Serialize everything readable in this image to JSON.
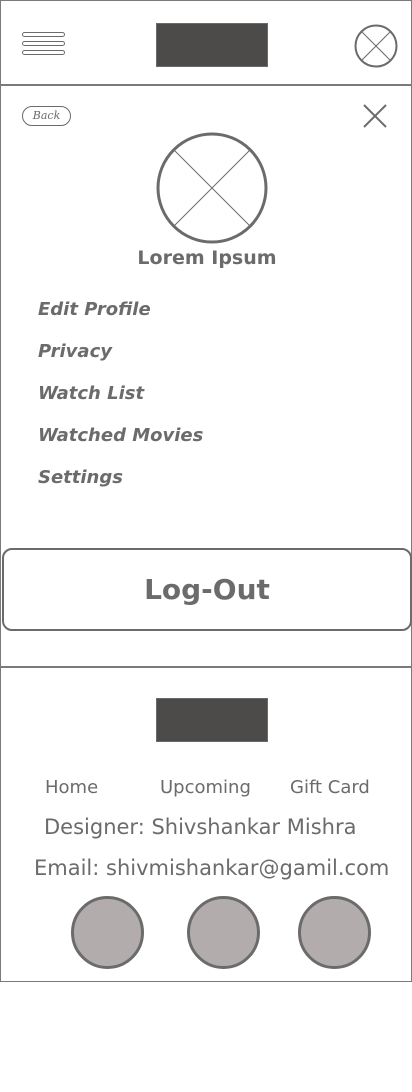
{
  "header": {
    "menu_icon": "hamburger-icon",
    "logo": "logo-placeholder",
    "avatar_icon": "image-placeholder-icon"
  },
  "panel": {
    "back_label": "Back",
    "close_icon": "close-icon",
    "profile_icon": "image-placeholder-icon",
    "profile_name": "Lorem Ipsum",
    "menu_items": [
      "Edit Profile",
      "Privacy",
      "Watch List",
      "Watched Movies",
      "Settings"
    ],
    "logout_label": "Log-Out"
  },
  "footer": {
    "links": [
      "Home",
      "Upcoming",
      "Gift Card"
    ],
    "designer": "Designer: Shivshankar Mishra",
    "email": "Email: shivmishankar@gamil.com",
    "social_icons": [
      "social-icon",
      "social-icon",
      "social-icon"
    ]
  },
  "colors": {
    "stroke": "#6b6b6b",
    "logo_fill": "#4d4a4a",
    "social_fill": "#b3acac"
  }
}
